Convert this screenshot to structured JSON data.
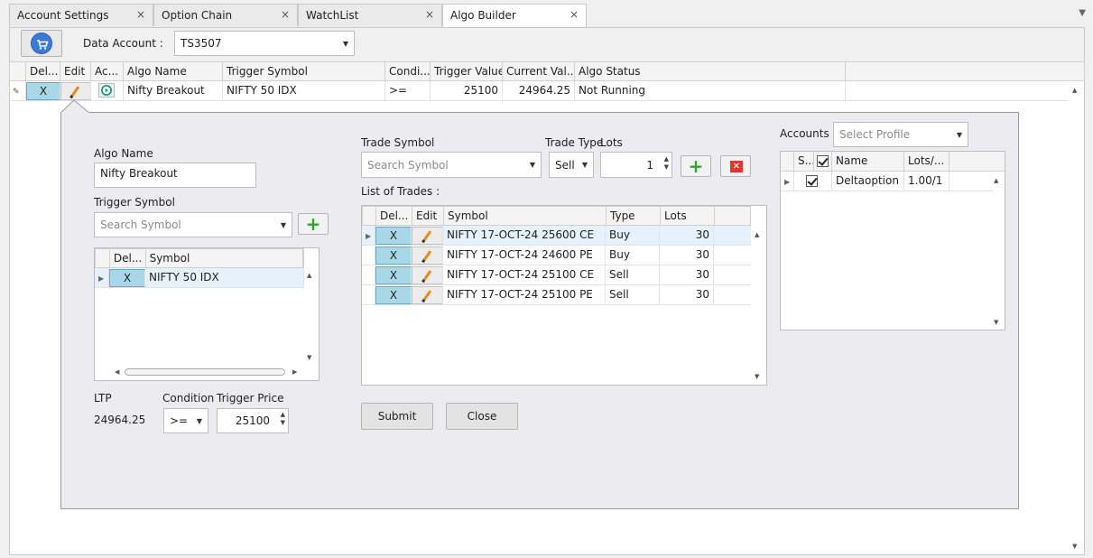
{
  "tabs": [
    {
      "label": "Account Settings",
      "close": "×"
    },
    {
      "label": "Option Chain",
      "close": "×"
    },
    {
      "label": "WatchList",
      "close": "×"
    },
    {
      "label": "Algo Builder",
      "close": "×"
    }
  ],
  "toolbar": {
    "data_account_label": "Data Account :",
    "data_account_value": "TS3507"
  },
  "algo_grid": {
    "headers": [
      "Del...",
      "Edit",
      "Ac...",
      "Algo Name",
      "Trigger Symbol",
      "Condi...",
      "Trigger Value",
      "Current Val...",
      "Algo Status"
    ],
    "row": {
      "del": "X",
      "algo_name": "Nifty Breakout",
      "trigger_symbol": "NIFTY 50 IDX",
      "condition": ">=",
      "trigger_value": "25100",
      "current_value": "24964.25",
      "status": "Not Running"
    }
  },
  "detail": {
    "algo_name_label": "Algo Name",
    "algo_name_value": "Nifty Breakout",
    "trigger_symbol_label": "Trigger Symbol",
    "trigger_symbol_placeholder": "Search Symbol",
    "symbol_grid_headers": [
      "Del...",
      "Symbol"
    ],
    "symbol_row": {
      "del": "X",
      "symbol": "NIFTY 50 IDX"
    },
    "ltp_label": "LTP",
    "ltp_value": "24964.25",
    "condition_label": "Condition",
    "condition_value": ">=",
    "trigger_price_label": "Trigger Price",
    "trigger_price_value": "25100",
    "trade_symbol_label": "Trade Symbol",
    "trade_symbol_placeholder": "Search Symbol",
    "trade_type_label": "Trade Type",
    "trade_type_value": "Sell",
    "lots_label": "Lots",
    "lots_value": "1",
    "list_of_trades_label": "List of Trades :",
    "trades_headers": [
      "Del...",
      "Edit",
      "Symbol",
      "Type",
      "Lots"
    ],
    "trades": [
      {
        "del": "X",
        "symbol": "NIFTY 17-OCT-24 25600 CE",
        "type": "Buy",
        "lots": "30"
      },
      {
        "del": "X",
        "symbol": "NIFTY 17-OCT-24 24600 PE",
        "type": "Buy",
        "lots": "30"
      },
      {
        "del": "X",
        "symbol": "NIFTY 17-OCT-24 25100 CE",
        "type": "Sell",
        "lots": "30"
      },
      {
        "del": "X",
        "symbol": "NIFTY 17-OCT-24 25100 PE",
        "type": "Sell",
        "lots": "30"
      }
    ],
    "submit_label": "Submit",
    "close_label": "Close",
    "accounts_label": "Accounts :",
    "accounts_placeholder": "Select Profile",
    "accounts_headers": [
      "S...",
      "Name",
      "Lots/..."
    ],
    "accounts_rows": [
      {
        "name": "Deltaoption",
        "lots": "1.00/1",
        "selected": true
      }
    ]
  },
  "colors": {
    "accent": "#3a7bd5",
    "delete_cell": "#a8d8e8",
    "add_icon": "#2ea52e",
    "delete_icon": "#d93a2b"
  },
  "icons": [
    "cart-icon",
    "pencil-icon",
    "play-icon",
    "plus-icon",
    "delete-x-icon",
    "checkbox-icon"
  ]
}
